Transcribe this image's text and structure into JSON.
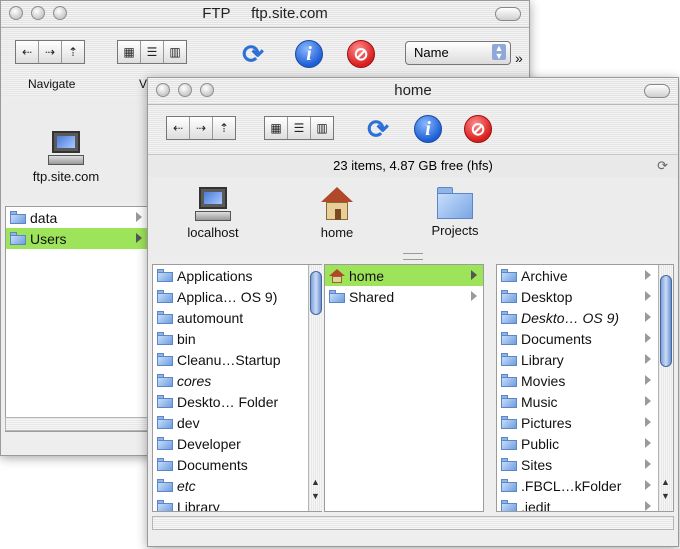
{
  "back_window": {
    "title": "FTP",
    "subtitle": "ftp.site.com",
    "toolbar": {
      "navigate_label": "Navigate",
      "view_label_partial": "V",
      "sort_select": "Name"
    },
    "server_label": "ftp.site.com",
    "items": [
      {
        "label": "data",
        "selected": false
      },
      {
        "label": "Users",
        "selected": true
      }
    ]
  },
  "front_window": {
    "title": "home",
    "status": "23 items, 4.87 GB free (hfs)",
    "shelf": [
      {
        "label": "localhost",
        "icon": "computer-icon"
      },
      {
        "label": "home",
        "icon": "home-icon"
      },
      {
        "label": "Projects",
        "icon": "folder-icon"
      }
    ],
    "column1": [
      {
        "label": "Applications",
        "italic": false
      },
      {
        "label": "Applica… OS 9)",
        "italic": false
      },
      {
        "label": "automount",
        "italic": false
      },
      {
        "label": "bin",
        "italic": false
      },
      {
        "label": "Cleanu…Startup",
        "italic": false
      },
      {
        "label": "cores",
        "italic": true
      },
      {
        "label": "Deskto… Folder",
        "italic": false
      },
      {
        "label": "dev",
        "italic": false
      },
      {
        "label": "Developer",
        "italic": false
      },
      {
        "label": "Documents",
        "italic": false
      },
      {
        "label": "etc",
        "italic": true
      },
      {
        "label": "Library",
        "italic": false
      }
    ],
    "column2": [
      {
        "label": "home",
        "selected": true
      },
      {
        "label": "Shared",
        "selected": false
      }
    ],
    "column3": [
      {
        "label": "Archive",
        "italic": false
      },
      {
        "label": "Desktop",
        "italic": false
      },
      {
        "label": "Deskto… OS 9)",
        "italic": true
      },
      {
        "label": "Documents",
        "italic": false
      },
      {
        "label": "Library",
        "italic": false
      },
      {
        "label": "Movies",
        "italic": false
      },
      {
        "label": "Music",
        "italic": false
      },
      {
        "label": "Pictures",
        "italic": false
      },
      {
        "label": "Public",
        "italic": false
      },
      {
        "label": "Sites",
        "italic": false
      },
      {
        "label": ".FBCL…kFolder",
        "italic": false
      },
      {
        "label": ".iedit",
        "italic": false
      }
    ]
  }
}
